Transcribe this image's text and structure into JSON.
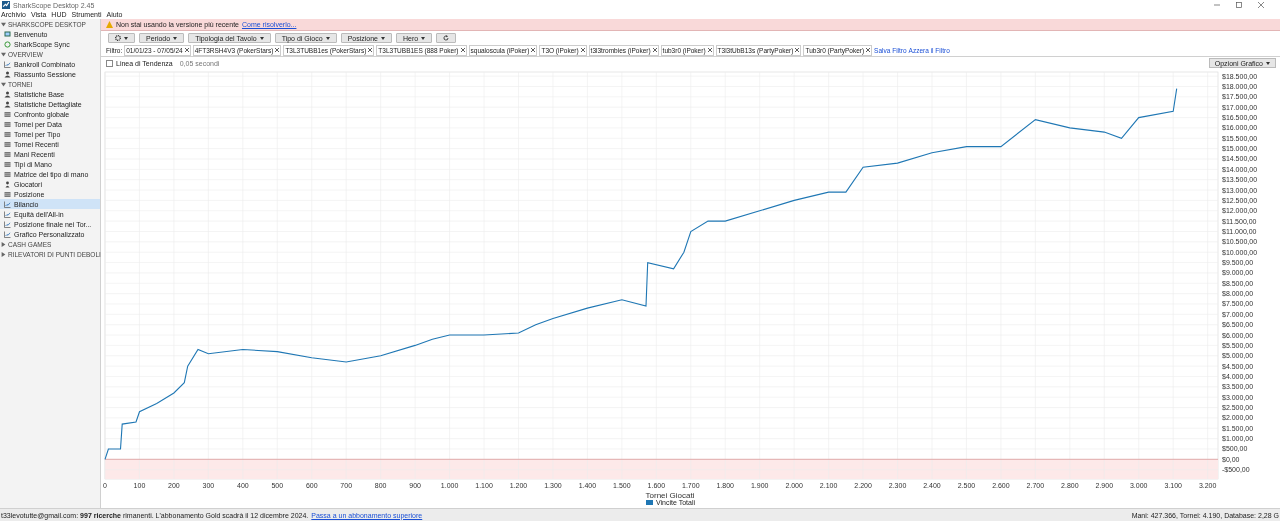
{
  "window": {
    "title": "SharkScope Desktop 2.45"
  },
  "menu": [
    "Archivio",
    "Vista",
    "HUD",
    "Strumenti",
    "Aiuto"
  ],
  "sidebar": {
    "sections": [
      {
        "label": "SHARKSCOPE DESKTOP",
        "expanded": true,
        "items": [
          {
            "label": "Benvenuto",
            "kind": "welcome",
            "selected": false
          },
          {
            "label": "SharkScope Sync",
            "kind": "sync",
            "selected": false
          }
        ]
      },
      {
        "label": "OVERVIEW",
        "expanded": true,
        "items": [
          {
            "label": "Bankroll Combinato",
            "kind": "graph",
            "selected": false
          },
          {
            "label": "Riassunto Sessione",
            "kind": "stats",
            "selected": false
          }
        ]
      },
      {
        "label": "TORNEI",
        "expanded": true,
        "items": [
          {
            "label": "Statistiche Base",
            "kind": "stats",
            "selected": false
          },
          {
            "label": "Statistiche Dettagliate",
            "kind": "stats",
            "selected": false
          },
          {
            "label": "Confronto globale",
            "kind": "table",
            "selected": false
          },
          {
            "label": "Tornei per Data",
            "kind": "table",
            "selected": false
          },
          {
            "label": "Tornei per Tipo",
            "kind": "table",
            "selected": false
          },
          {
            "label": "Tornei Recenti",
            "kind": "table",
            "selected": false
          },
          {
            "label": "Mani Recenti",
            "kind": "table",
            "selected": false
          },
          {
            "label": "Tipi di Mano",
            "kind": "table",
            "selected": false
          },
          {
            "label": "Matrice del tipo di mano",
            "kind": "table",
            "selected": false
          },
          {
            "label": "Giocatori",
            "kind": "player",
            "selected": false
          },
          {
            "label": "Posizione",
            "kind": "table",
            "selected": false
          },
          {
            "label": "Bilancio",
            "kind": "graph",
            "selected": true
          },
          {
            "label": "Equità dell'All-in",
            "kind": "graph",
            "selected": false
          },
          {
            "label": "Posizione finale nei Tor...",
            "kind": "graph",
            "selected": false
          },
          {
            "label": "Grafico Personalizzato",
            "kind": "graph",
            "selected": false
          }
        ]
      },
      {
        "label": "CASH GAMES",
        "expanded": false
      },
      {
        "label": "RILEVATORI DI PUNTI DEBOLI",
        "expanded": false
      }
    ]
  },
  "banner": {
    "text": "Non stai usando la versione più recente",
    "link": "Come risolverlo..."
  },
  "toolbar": [
    {
      "kind": "gear"
    },
    {
      "label": "Periodo",
      "kind": "dropdown"
    },
    {
      "label": "Tipologia del Tavolo",
      "kind": "dropdown"
    },
    {
      "label": "Tipo di Gioco",
      "kind": "dropdown"
    },
    {
      "label": "Posizione",
      "kind": "dropdown"
    },
    {
      "label": "Hero",
      "kind": "dropdown"
    },
    {
      "kind": "refresh"
    }
  ],
  "filter": {
    "label": "Filtro:",
    "chips": [
      "01/01/23 - 07/05/24",
      "4FT3RSH4V3 (PokerStars)",
      "T3L3TUBB1es (PokerStars)",
      "T3L3TUBB1ES (888 Poker)",
      "squaloscula (iPoker)",
      "T3O (iPoker)",
      "t3l3trombies (iPoker)",
      "tub3r0 (iPoker)",
      "T3l3tUbB13s (PartyPoker)",
      "Tub3r0 (PartyPoker)"
    ],
    "links": [
      "Salva Filtro",
      "Azzera il Filtro"
    ]
  },
  "trend": {
    "label": "Linea di Tendenza",
    "checked": false,
    "timing": "0,05 secondi"
  },
  "chart_options": "Opzioni Grafico",
  "chart_data": {
    "type": "line",
    "xlabel": "Tornei Giocati",
    "xlim": [
      0,
      3230
    ],
    "ylim": [
      -950,
      18700
    ],
    "grid": true,
    "ref_lines": [
      {
        "axis": "y",
        "value": 0,
        "color": "#dd9999"
      }
    ],
    "bands": [
      {
        "axis": "y",
        "from": -950,
        "to": 0,
        "color": "#fde9e9"
      }
    ],
    "xticks": [
      {
        "value": 0,
        "label": "0"
      },
      {
        "value": 100,
        "label": "100"
      },
      {
        "value": 200,
        "label": "200"
      },
      {
        "value": 300,
        "label": "300"
      },
      {
        "value": 400,
        "label": "400"
      },
      {
        "value": 500,
        "label": "500"
      },
      {
        "value": 600,
        "label": "600"
      },
      {
        "value": 700,
        "label": "700"
      },
      {
        "value": 800,
        "label": "800"
      },
      {
        "value": 900,
        "label": "900"
      },
      {
        "value": 1000,
        "label": "1.000"
      },
      {
        "value": 1100,
        "label": "1.100"
      },
      {
        "value": 1200,
        "label": "1.200"
      },
      {
        "value": 1300,
        "label": "1.300"
      },
      {
        "value": 1400,
        "label": "1.400"
      },
      {
        "value": 1500,
        "label": "1.500"
      },
      {
        "value": 1600,
        "label": "1.600"
      },
      {
        "value": 1700,
        "label": "1.700"
      },
      {
        "value": 1800,
        "label": "1.800"
      },
      {
        "value": 1900,
        "label": "1.900"
      },
      {
        "value": 2000,
        "label": "2.000"
      },
      {
        "value": 2100,
        "label": "2.100"
      },
      {
        "value": 2200,
        "label": "2.200"
      },
      {
        "value": 2300,
        "label": "2.300"
      },
      {
        "value": 2400,
        "label": "2.400"
      },
      {
        "value": 2500,
        "label": "2.500"
      },
      {
        "value": 2600,
        "label": "2.600"
      },
      {
        "value": 2700,
        "label": "2.700"
      },
      {
        "value": 2800,
        "label": "2.800"
      },
      {
        "value": 2900,
        "label": "2.900"
      },
      {
        "value": 3000,
        "label": "3.000"
      },
      {
        "value": 3100,
        "label": "3.100"
      },
      {
        "value": 3200,
        "label": "3.200"
      }
    ],
    "yticks": [
      {
        "value": -500,
        "label": "-$500,00"
      },
      {
        "value": 0,
        "label": "$0,00"
      },
      {
        "value": 500,
        "label": "$500,00"
      },
      {
        "value": 1000,
        "label": "$1.000,00"
      },
      {
        "value": 1500,
        "label": "$1.500,00"
      },
      {
        "value": 2000,
        "label": "$2.000,00"
      },
      {
        "value": 2500,
        "label": "$2.500,00"
      },
      {
        "value": 3000,
        "label": "$3.000,00"
      },
      {
        "value": 3500,
        "label": "$3.500,00"
      },
      {
        "value": 4000,
        "label": "$4.000,00"
      },
      {
        "value": 4500,
        "label": "$4.500,00"
      },
      {
        "value": 5000,
        "label": "$5.000,00"
      },
      {
        "value": 5500,
        "label": "$5.500,00"
      },
      {
        "value": 6000,
        "label": "$6.000,00"
      },
      {
        "value": 6500,
        "label": "$6.500,00"
      },
      {
        "value": 7000,
        "label": "$7.000,00"
      },
      {
        "value": 7500,
        "label": "$7.500,00"
      },
      {
        "value": 8000,
        "label": "$8.000,00"
      },
      {
        "value": 8500,
        "label": "$8.500,00"
      },
      {
        "value": 9000,
        "label": "$9.000,00"
      },
      {
        "value": 9500,
        "label": "$9.500,00"
      },
      {
        "value": 10000,
        "label": "$10.000,00"
      },
      {
        "value": 10500,
        "label": "$10.500,00"
      },
      {
        "value": 11000,
        "label": "$11.000,00"
      },
      {
        "value": 11500,
        "label": "$11.500,00"
      },
      {
        "value": 12000,
        "label": "$12.000,00"
      },
      {
        "value": 12500,
        "label": "$12.500,00"
      },
      {
        "value": 13000,
        "label": "$13.000,00"
      },
      {
        "value": 13500,
        "label": "$13.500,00"
      },
      {
        "value": 14000,
        "label": "$14.000,00"
      },
      {
        "value": 14500,
        "label": "$14.500,00"
      },
      {
        "value": 15000,
        "label": "$15.000,00"
      },
      {
        "value": 15500,
        "label": "$15.500,00"
      },
      {
        "value": 16000,
        "label": "$16.000,00"
      },
      {
        "value": 16500,
        "label": "$16.500,00"
      },
      {
        "value": 17000,
        "label": "$17.000,00"
      },
      {
        "value": 17500,
        "label": "$17.500,00"
      },
      {
        "value": 18000,
        "label": "$18.000,00"
      },
      {
        "value": 18500,
        "label": "$18.500,00"
      }
    ],
    "x": [
      0,
      10,
      45,
      50,
      90,
      100,
      150,
      200,
      230,
      240,
      270,
      300,
      400,
      500,
      600,
      700,
      800,
      900,
      950,
      1000,
      1100,
      1200,
      1250,
      1300,
      1400,
      1500,
      1570,
      1575,
      1650,
      1680,
      1700,
      1750,
      1800,
      1900,
      2000,
      2100,
      2150,
      2200,
      2300,
      2400,
      2500,
      2600,
      2700,
      2800,
      2900,
      2950,
      3000,
      3100,
      3110
    ],
    "series": [
      {
        "name": "Vincite Totali",
        "color": "#1f77b4",
        "values": [
          0,
          500,
          500,
          1700,
          1800,
          2300,
          2700,
          3200,
          3700,
          4500,
          5300,
          5100,
          5300,
          5200,
          4900,
          4700,
          5000,
          5500,
          5800,
          6000,
          6000,
          6100,
          6500,
          6800,
          7300,
          7700,
          7400,
          9500,
          9200,
          10000,
          11000,
          11500,
          11500,
          12000,
          12500,
          12900,
          12900,
          14100,
          14300,
          14800,
          15100,
          15100,
          16400,
          16000,
          15800,
          15500,
          16500,
          16800,
          17900
        ]
      }
    ]
  },
  "status": {
    "account": "t33levotutte@gmail.com: **997 ricerche** rimanenti. L'abbonamento Gold scadrà il 12 dicembre 2024.",
    "link": "Passa a un abbonamento superiore",
    "stats": "Mani: 427.366, Tornei: 4.190, Database: 2,28 G"
  }
}
